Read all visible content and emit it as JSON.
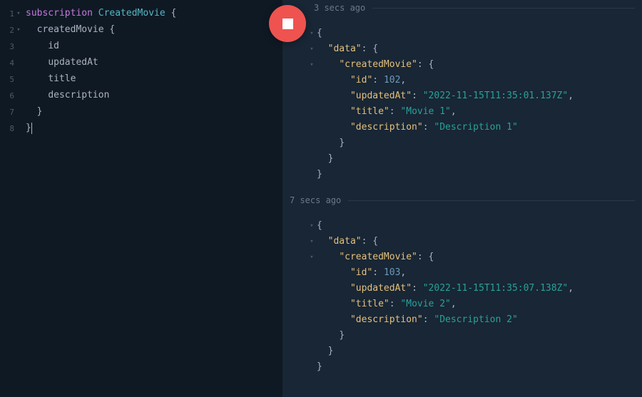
{
  "query": {
    "lines": [
      {
        "num": "1",
        "fold": true,
        "tokens": [
          {
            "t": "kw",
            "v": "subscription"
          },
          {
            "t": "sp",
            "v": " "
          },
          {
            "t": "name",
            "v": "CreatedMovie"
          },
          {
            "t": "sp",
            "v": " "
          },
          {
            "t": "brace",
            "v": "{"
          }
        ]
      },
      {
        "num": "2",
        "fold": true,
        "tokens": [
          {
            "t": "sp",
            "v": "  "
          },
          {
            "t": "field",
            "v": "createdMovie"
          },
          {
            "t": "sp",
            "v": " "
          },
          {
            "t": "brace",
            "v": "{"
          }
        ]
      },
      {
        "num": "3",
        "fold": false,
        "tokens": [
          {
            "t": "sp",
            "v": "    "
          },
          {
            "t": "field",
            "v": "id"
          }
        ]
      },
      {
        "num": "4",
        "fold": false,
        "tokens": [
          {
            "t": "sp",
            "v": "    "
          },
          {
            "t": "field",
            "v": "updatedAt"
          }
        ]
      },
      {
        "num": "5",
        "fold": false,
        "tokens": [
          {
            "t": "sp",
            "v": "    "
          },
          {
            "t": "field",
            "v": "title"
          }
        ]
      },
      {
        "num": "6",
        "fold": false,
        "tokens": [
          {
            "t": "sp",
            "v": "    "
          },
          {
            "t": "field",
            "v": "description"
          }
        ]
      },
      {
        "num": "7",
        "fold": false,
        "tokens": [
          {
            "t": "sp",
            "v": "  "
          },
          {
            "t": "brace",
            "v": "}"
          }
        ]
      },
      {
        "num": "8",
        "fold": false,
        "tokens": [
          {
            "t": "brace",
            "v": "}"
          }
        ],
        "cursor": true
      }
    ]
  },
  "events": [
    {
      "time_label": "3 secs ago",
      "data": {
        "createdMovie": {
          "id": 102,
          "updatedAt": "2022-11-15T11:35:01.137Z",
          "title": "Movie 1",
          "description": "Description 1"
        }
      }
    },
    {
      "time_label": "7 secs ago",
      "data": {
        "createdMovie": {
          "id": 103,
          "updatedAt": "2022-11-15T11:35:07.138Z",
          "title": "Movie 2",
          "description": "Description 2"
        }
      }
    }
  ]
}
